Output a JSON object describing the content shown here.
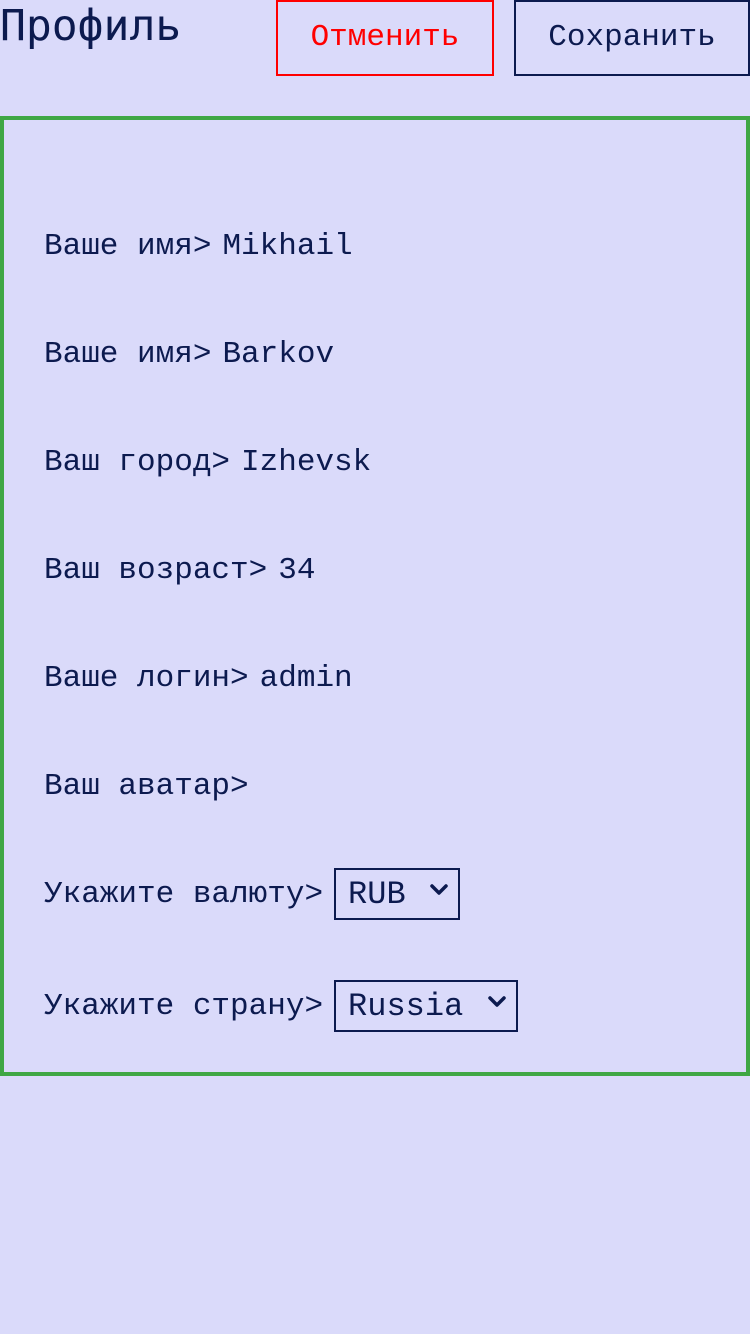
{
  "header": {
    "title": "Профиль",
    "cancel_label": "Отменить",
    "save_label": "Сохранить"
  },
  "form": {
    "fields": [
      {
        "label": "Ваше имя>",
        "value": "Mikhail"
      },
      {
        "label": "Ваше имя>",
        "value": "Barkov"
      },
      {
        "label": "Ваш город>",
        "value": "Izhevsk"
      },
      {
        "label": "Ваш возраст>",
        "value": "34"
      },
      {
        "label": "Ваше логин>",
        "value": "admin"
      },
      {
        "label": "Ваш аватар>",
        "value": ""
      }
    ],
    "currency": {
      "label": "Укажите валюту>",
      "selected": "RUB"
    },
    "country": {
      "label": "Укажите страну>",
      "selected": "Russia"
    }
  },
  "colors": {
    "background": "#dadafa",
    "text": "#0c1a4f",
    "cancel": "#ff0000",
    "panel_border": "#3fa744"
  },
  "icons": {
    "select_arrow": "chevron-down-icon"
  }
}
